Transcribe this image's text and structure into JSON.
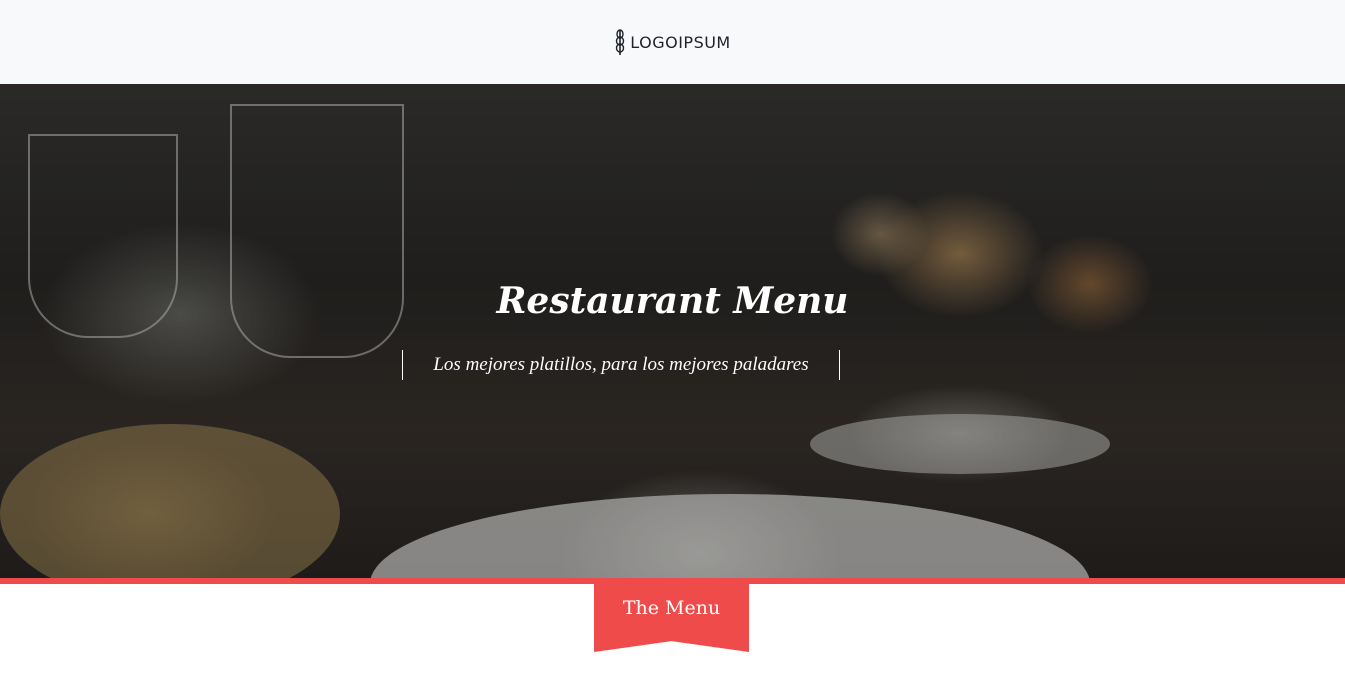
{
  "header": {
    "logo_text": "LOGOIPSUM",
    "logo_icon": "wheat-icon"
  },
  "hero": {
    "title": "Restaurant Menu",
    "subtitle": "Los mejores platillos, para los mejores paladares"
  },
  "section": {
    "ribbon_label": "The Menu"
  },
  "colors": {
    "accent": "#ef4b4b",
    "topbar_bg": "#f8f9fb",
    "text_light": "#ffffff"
  }
}
